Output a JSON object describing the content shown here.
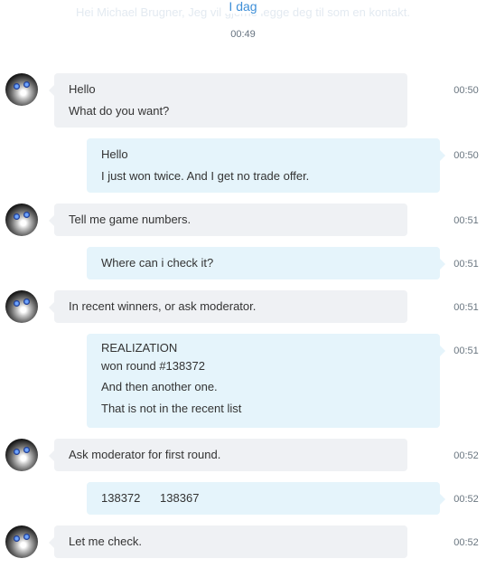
{
  "header": {
    "faded_text": "Hei Michael Brugner, Jeg vil gjerne legge deg til som en kontakt.",
    "day_label": "I dag",
    "day_time": "00:49"
  },
  "messages": [
    {
      "direction": "in",
      "lines": [
        "Hello",
        "What do you want?"
      ],
      "time": "00:50"
    },
    {
      "direction": "out",
      "lines": [
        "Hello",
        "I just won twice. And I get no trade offer."
      ],
      "time": "00:50"
    },
    {
      "direction": "in",
      "lines": [
        "Tell me game numbers."
      ],
      "time": "00:51"
    },
    {
      "direction": "out",
      "lines": [
        "Where can i check it?"
      ],
      "time": "00:51"
    },
    {
      "direction": "in",
      "lines": [
        "In recent winners, or ask moderator."
      ],
      "time": "00:51"
    },
    {
      "direction": "out",
      "lines": [
        "REALIZATION",
        "won round #138372",
        "And then another one.",
        "That is not in the recent list"
      ],
      "time": "00:51"
    },
    {
      "direction": "in",
      "lines": [
        "Ask moderator for first round."
      ],
      "time": "00:52"
    },
    {
      "direction": "out",
      "lines": [
        "138372      138367"
      ],
      "time": "00:52"
    },
    {
      "direction": "in",
      "lines": [
        "Let me check."
      ],
      "time": "00:52"
    }
  ]
}
